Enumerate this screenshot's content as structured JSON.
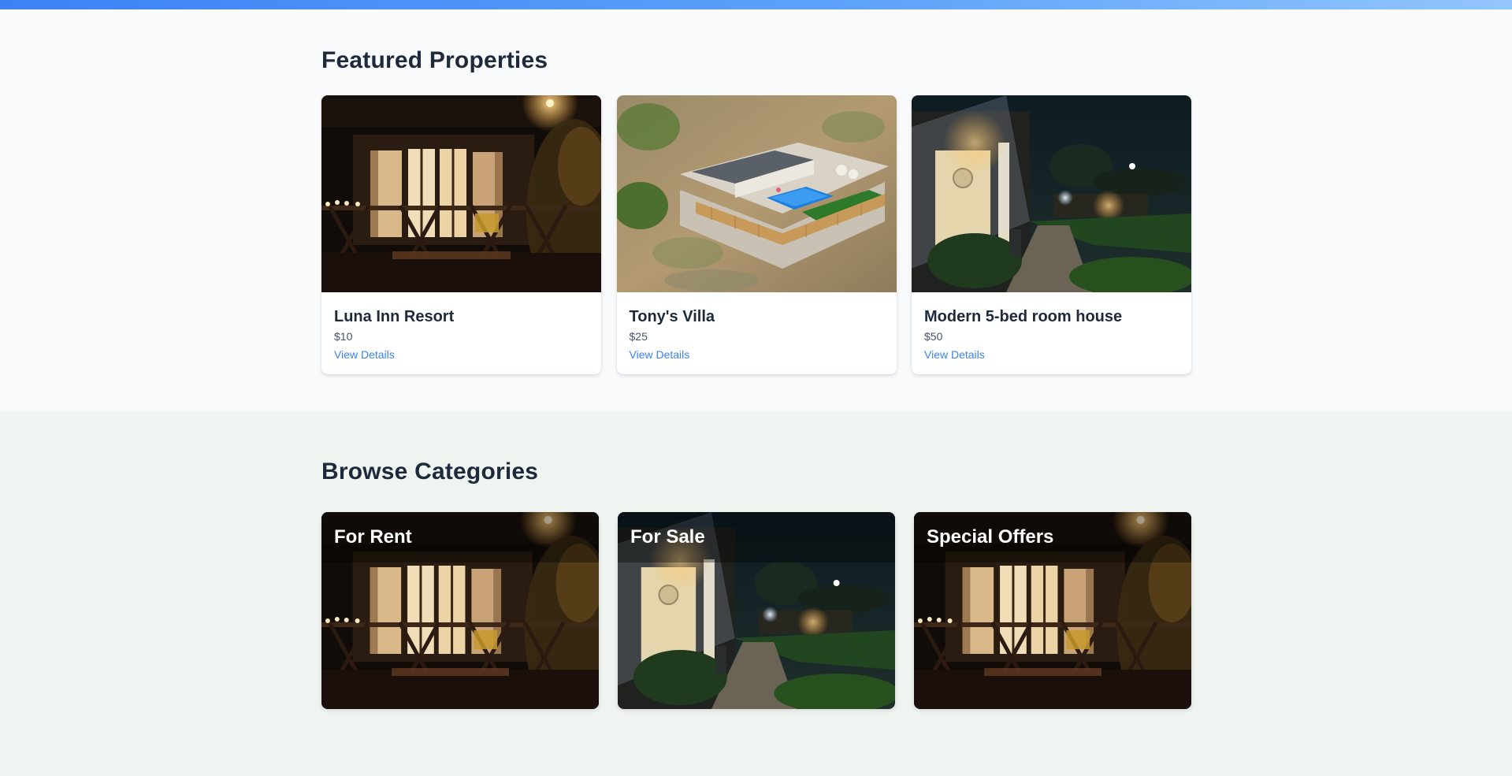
{
  "featured": {
    "heading": "Featured Properties",
    "properties": [
      {
        "title": "Luna Inn Resort",
        "price": "$10",
        "link_label": "View Details",
        "photo": "night-terrace-photo"
      },
      {
        "title": "Tony's Villa",
        "price": "$25",
        "link_label": "View Details",
        "photo": "aerial-villa-pool-photo"
      },
      {
        "title": "Modern 5-bed room house",
        "price": "$50",
        "link_label": "View Details",
        "photo": "night-garden-house-photo"
      }
    ]
  },
  "categories": {
    "heading": "Browse Categories",
    "items": [
      {
        "label": "For Rent",
        "photo": "night-terrace-photo"
      },
      {
        "label": "For Sale",
        "photo": "night-garden-house-photo"
      },
      {
        "label": "Special Offers",
        "photo": "night-terrace-photo"
      }
    ]
  },
  "colors": {
    "accent": "#3b82f6",
    "heading": "#1e293b",
    "featured_bg": "#f8fafc",
    "browse_bg": "#f0f4f1"
  }
}
